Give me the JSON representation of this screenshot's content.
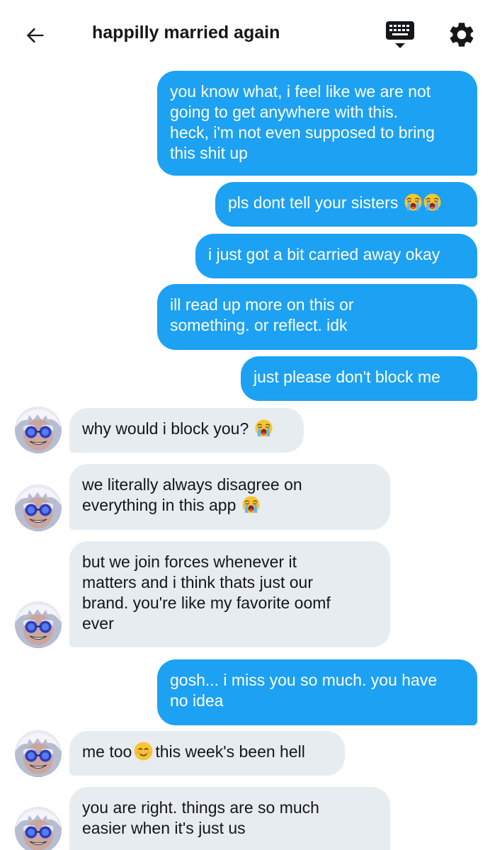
{
  "header": {
    "title": "happilly married again",
    "back_icon": "arrow-left-icon",
    "keyboard_icon": "keyboard-icon",
    "settings_icon": "gear-icon"
  },
  "colors": {
    "sent_bubble": "#1da1f2",
    "received_bubble": "#e6ecf0",
    "text": "#14171a"
  },
  "messages": [
    {
      "from": "me",
      "lines": [
        "you know what, i feel like we are not",
        "going to get anywhere with this.",
        "heck, i'm not even supposed to bring",
        "this shit up"
      ]
    },
    {
      "from": "me",
      "lines": [
        "pls dont tell your sisters"
      ],
      "emojis": [
        "loudly-crying-face",
        "loudly-crying-face"
      ]
    },
    {
      "from": "me",
      "lines": [
        "i just got a bit carried away okay"
      ]
    },
    {
      "from": "me",
      "lines": [
        "ill read up more on this or",
        "something. or reflect. idk"
      ]
    },
    {
      "from": "me",
      "lines": [
        "just please don't block me"
      ]
    },
    {
      "from": "them",
      "lines": [
        "why would i block you?"
      ],
      "emojis": [
        "loudly-crying-face"
      ]
    },
    {
      "from": "them",
      "lines": [
        "we literally always disagree on",
        "everything in this app"
      ],
      "emojis": [
        "loudly-crying-face"
      ]
    },
    {
      "from": "them",
      "lines": [
        "but we join forces whenever it",
        "matters and i think thats just our",
        "brand. you're like my favorite oomf",
        "ever"
      ]
    },
    {
      "from": "me",
      "lines": [
        "gosh... i miss you so much. you have",
        "no idea"
      ]
    },
    {
      "from": "them",
      "lines": [
        "me too",
        "this week's been hell"
      ],
      "emojis": [
        "smiling-face-with-smiling-eyes"
      ]
    },
    {
      "from": "them",
      "lines": [
        "you are right. things are so much",
        "easier when it's just us"
      ]
    }
  ]
}
